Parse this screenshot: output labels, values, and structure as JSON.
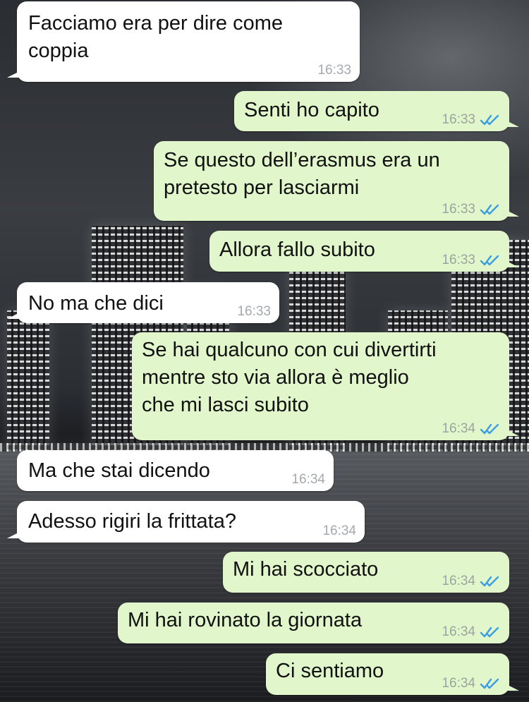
{
  "messages": [
    {
      "direction": "incoming",
      "text": "Facciamo era per dire come\ncoppia",
      "time": "16:33"
    },
    {
      "direction": "outgoing",
      "text": "Senti ho capito",
      "time": "16:33",
      "status": "read"
    },
    {
      "direction": "outgoing",
      "text": "Se questo dell’erasmus era un\npretesto per lasciarmi",
      "time": "16:33",
      "status": "read"
    },
    {
      "direction": "outgoing",
      "text": "Allora fallo subito",
      "time": "16:33",
      "status": "read"
    },
    {
      "direction": "incoming",
      "text": "No ma che dici",
      "time": "16:33"
    },
    {
      "direction": "outgoing",
      "text": "Se hai qualcuno con cui divertirti\nmentre sto via allora è meglio\nche mi lasci subito",
      "time": "16:34",
      "status": "read"
    },
    {
      "direction": "incoming",
      "text": "Ma che stai dicendo",
      "time": "16:34"
    },
    {
      "direction": "incoming",
      "text": "Adesso rigiri la frittata?",
      "time": "16:34"
    },
    {
      "direction": "outgoing",
      "text": "Mi hai scocciato",
      "time": "16:34",
      "status": "read"
    },
    {
      "direction": "outgoing",
      "text": "Mi hai rovinato la giornata",
      "time": "16:34",
      "status": "read"
    },
    {
      "direction": "outgoing",
      "text": "Ci sentiamo",
      "time": "16:34",
      "status": "read"
    }
  ],
  "colors": {
    "incoming_bubble": "#ffffff",
    "outgoing_bubble": "#e1f6cb",
    "read_ticks": "#3a9ee4",
    "timestamp": "#a3a9ae"
  },
  "icons": {
    "read_receipt": "double-check-icon",
    "background": "night-city-skyline"
  }
}
